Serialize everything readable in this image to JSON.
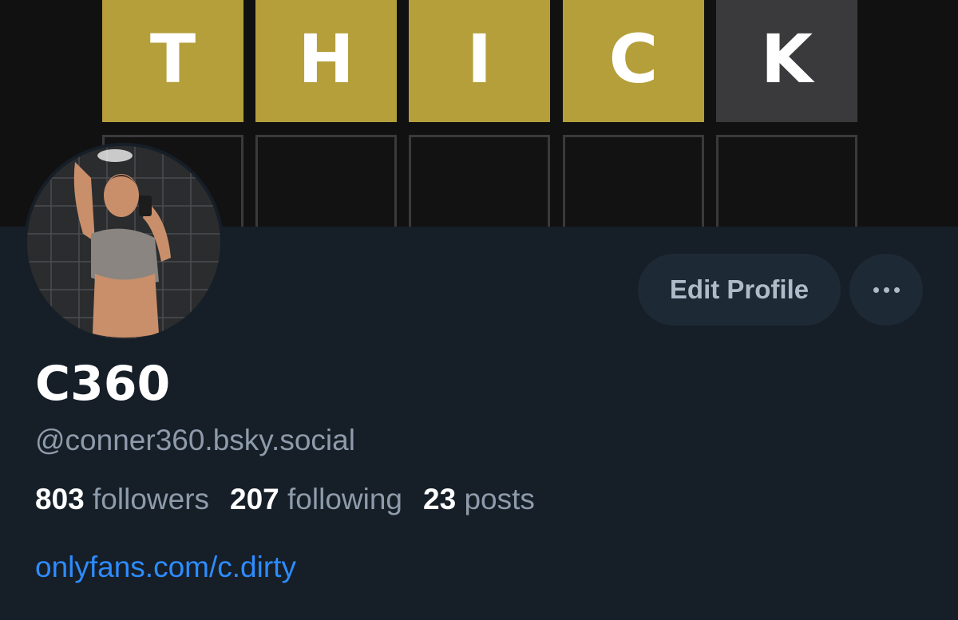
{
  "banner": {
    "tiles": [
      {
        "letter": "T",
        "state": "yellow"
      },
      {
        "letter": "H",
        "state": "yellow"
      },
      {
        "letter": "I",
        "state": "yellow"
      },
      {
        "letter": "C",
        "state": "yellow"
      },
      {
        "letter": "K",
        "state": "gray"
      }
    ],
    "colors": {
      "yellow": "#b59f3b",
      "gray": "#3a3a3c",
      "empty_border": "#3a3a3c"
    }
  },
  "profile": {
    "display_name": "C360",
    "handle": "@conner360.bsky.social",
    "stats": {
      "followers_count": "803",
      "followers_label": "followers",
      "following_count": "207",
      "following_label": "following",
      "posts_count": "23",
      "posts_label": "posts"
    },
    "link": "onlyfans.com/c.dirty"
  },
  "actions": {
    "edit_label": "Edit Profile",
    "more_icon": "ellipsis-icon"
  },
  "theme": {
    "background": "#161e27",
    "button_bg": "#1e2936",
    "link_color": "#2d8cff",
    "muted_text": "#8e9bab"
  }
}
